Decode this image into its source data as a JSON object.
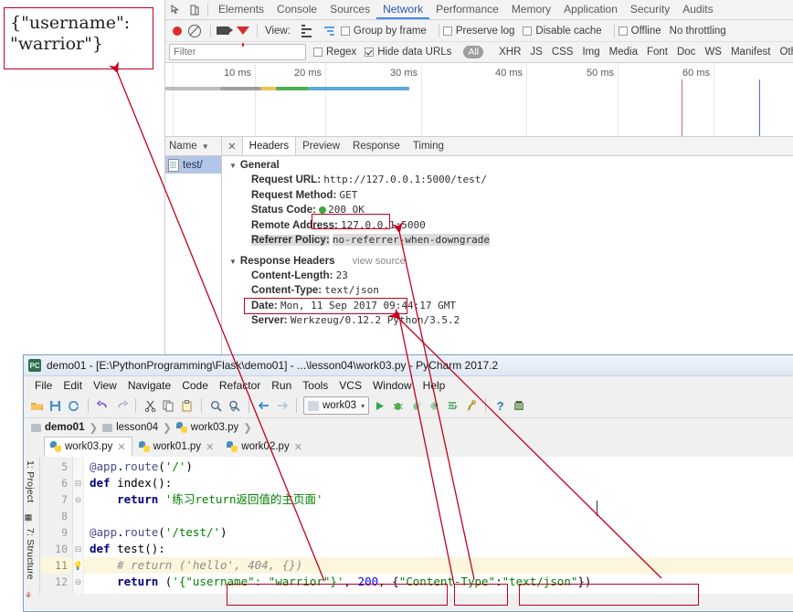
{
  "devtools": {
    "tabs": [
      {
        "label": "Elements",
        "selected": false
      },
      {
        "label": "Console",
        "selected": false
      },
      {
        "label": "Sources",
        "selected": false
      },
      {
        "label": "Network",
        "selected": true
      },
      {
        "label": "Performance",
        "selected": false
      },
      {
        "label": "Memory",
        "selected": false
      },
      {
        "label": "Application",
        "selected": false
      },
      {
        "label": "Security",
        "selected": false
      },
      {
        "label": "Audits",
        "selected": false
      }
    ],
    "toolbar": {
      "record_icon": "record-dot-icon",
      "clear_icon": "clear-no-entry-icon",
      "capture_screenshots_icon": "camera-icon",
      "filter_icon": "funnel-icon",
      "view_label": "View:",
      "list_view_icon": "list-view-icon",
      "waterfall_view_icon": "waterfall-view-icon",
      "group_by_frame": {
        "label": "Group by frame",
        "checked": false
      },
      "preserve_log": {
        "label": "Preserve log",
        "checked": false
      },
      "disable_cache": {
        "label": "Disable cache",
        "checked": false
      },
      "offline": {
        "label": "Offline",
        "checked": false
      },
      "throttling": "No throttling"
    },
    "filterbar": {
      "placeholder": "Filter",
      "value": "",
      "regex": {
        "label": "Regex",
        "checked": false
      },
      "hide_data_urls": {
        "label": "Hide data URLs",
        "checked": true
      },
      "types": [
        "All",
        "XHR",
        "JS",
        "CSS",
        "Img",
        "Media",
        "Font",
        "Doc",
        "WS",
        "Manifest",
        "Other"
      ],
      "selected_type": "All"
    },
    "timeline": {
      "ticks": [
        "10 ms",
        "20 ms",
        "30 ms",
        "40 ms",
        "50 ms",
        "60 ms"
      ],
      "event_lines": [
        {
          "color": "#d06a82",
          "x_pct": 74.0
        },
        {
          "color": "#5b6fc0",
          "x_pct": 85.5
        }
      ],
      "bar_segments": [
        {
          "color": "#bdbdbd",
          "start_pct": 0.0,
          "width_pct": 9.2
        },
        {
          "color": "#9e9e9e",
          "start_pct": 9.2,
          "width_pct": 6.3
        },
        {
          "color": "#f5c04e",
          "start_pct": 15.5,
          "width_pct": 2.2
        },
        {
          "color": "#4caf50",
          "start_pct": 17.7,
          "width_pct": 5.1
        },
        {
          "color": "#5ba7e0",
          "start_pct": 22.8,
          "width_pct": 15.0
        }
      ]
    },
    "names_panel": {
      "header": "Name",
      "sort_caret": "▼",
      "rows": [
        {
          "label": "test/",
          "selected": true,
          "icon": "document-icon"
        }
      ]
    },
    "detail_tabs": [
      {
        "label": "Headers",
        "selected": true
      },
      {
        "label": "Preview",
        "selected": false
      },
      {
        "label": "Response",
        "selected": false
      },
      {
        "label": "Timing",
        "selected": false
      }
    ],
    "general": {
      "title": "General",
      "rows": [
        {
          "key": "Request URL:",
          "value": "http://127.0.0.1:5000/test/",
          "highlight": false
        },
        {
          "key": "Request Method:",
          "value": "GET",
          "highlight": false
        },
        {
          "key": "Status Code:",
          "value": "200 OK",
          "highlight": false,
          "status_dot": "#3ea845"
        },
        {
          "key": "Remote Address:",
          "value": "127.0.0.1:5000",
          "highlight": false
        },
        {
          "key": "Referrer Policy:",
          "value": "no-referrer-when-downgrade",
          "highlight": true
        }
      ]
    },
    "response_headers": {
      "title": "Response Headers",
      "view_source": "view source",
      "rows": [
        {
          "key": "Content-Length:",
          "value": "23"
        },
        {
          "key": "Content-Type:",
          "value": "text/json"
        },
        {
          "key": "Date:",
          "value": "Mon, 11 Sep 2017 09:44:17 GMT"
        },
        {
          "key": "Server:",
          "value": "Werkzeug/0.12.2 Python/3.5.2"
        }
      ]
    }
  },
  "pycharm": {
    "title": "demo01 - [E:\\PythonProgramming\\Flask\\demo01] - ...\\lesson04\\work03.py - PyCharm 2017.2",
    "app_icon": "pycharm-icon",
    "menu": [
      "File",
      "Edit",
      "View",
      "Navigate",
      "Code",
      "Refactor",
      "Run",
      "Tools",
      "VCS",
      "Window",
      "Help"
    ],
    "toolbar_icons": [
      "open-folder-icon",
      "save-all-icon",
      "sync-icon",
      "undo-icon",
      "redo-icon",
      "cut-icon",
      "copy-icon",
      "paste-icon",
      "find-icon",
      "find-replace-icon",
      "back-icon",
      "forward-icon"
    ],
    "run_config": {
      "name": "work03",
      "caret": "▾",
      "icon": "run-config-icon"
    },
    "run_icons": [
      "run-icon",
      "debug-icon",
      "coverage-icon",
      "profile-icon",
      "run-with-console-icon",
      "attach-icon",
      "help-icon",
      "settings-icon"
    ],
    "breadcrumbs": [
      {
        "label": "demo01",
        "icon": "folder-icon",
        "bold": true
      },
      {
        "label": "lesson04",
        "icon": "folder-icon",
        "bold": false
      },
      {
        "label": "work03.py",
        "icon": "python-file-icon",
        "bold": false
      }
    ],
    "editor_tabs": [
      {
        "label": "work03.py",
        "selected": true,
        "icon": "python-file-icon"
      },
      {
        "label": "work01.py",
        "selected": false,
        "icon": "python-file-icon"
      },
      {
        "label": "work02.py",
        "selected": false,
        "icon": "python-file-icon"
      }
    ],
    "side_tabs": [
      {
        "label": "1: Project",
        "icon": "project-icon"
      },
      {
        "label": "7: Structure",
        "icon": "structure-icon"
      }
    ],
    "editor": {
      "line_numbers": [
        "5",
        "6",
        "7",
        "8",
        "9",
        "10",
        "11",
        "12"
      ],
      "current_line": "11",
      "lines": [
        {
          "num": "5",
          "text": "@app.route('/')"
        },
        {
          "num": "6",
          "text": "def index():"
        },
        {
          "num": "7",
          "text": "    return '练习return返回值的主页面'"
        },
        {
          "num": "8",
          "text": ""
        },
        {
          "num": "9",
          "text": "@app.route('/test/')"
        },
        {
          "num": "10",
          "text": "def test():"
        },
        {
          "num": "11",
          "text": "    # return ('hello', 404, {})"
        },
        {
          "num": "12",
          "text": "    return ('{\"username\": \"warrior\"}', 200, {\"Content-Type\":\"text/json\"})"
        }
      ]
    }
  },
  "annotations": {
    "accent_color": "#c2001e",
    "callout_text": "{\"username\":\n\"warrior\"}",
    "highlight_boxes": [
      {
        "name": "status-code-highlight",
        "label": "200 OK"
      },
      {
        "name": "content-type-highlight",
        "label": "Content-Type: text/json"
      },
      {
        "name": "code-json-body-highlight",
        "label": "{\"username\": \"warrior\"}"
      },
      {
        "name": "code-status-highlight",
        "label": "200,"
      },
      {
        "name": "code-headers-highlight",
        "label": "{\"Content-Type\":\"text/json\"})"
      }
    ]
  }
}
